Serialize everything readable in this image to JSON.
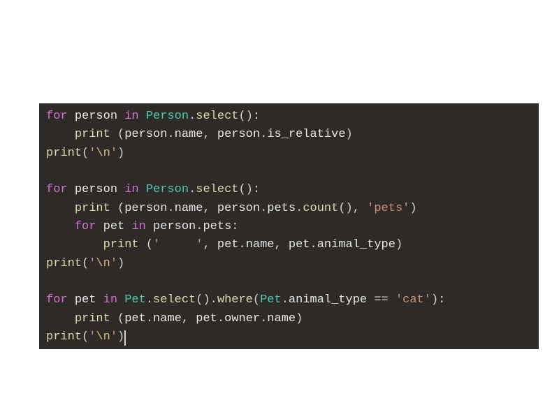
{
  "code": {
    "lines": [
      {
        "tokens": [
          {
            "text": "for",
            "type": "keyword"
          },
          {
            "text": " ",
            "type": "punct"
          },
          {
            "text": "person",
            "type": "variable"
          },
          {
            "text": " ",
            "type": "punct"
          },
          {
            "text": "in",
            "type": "keyword"
          },
          {
            "text": " ",
            "type": "punct"
          },
          {
            "text": "Person",
            "type": "class"
          },
          {
            "text": ".",
            "type": "punct"
          },
          {
            "text": "select",
            "type": "method"
          },
          {
            "text": "():",
            "type": "punct"
          }
        ],
        "indent": 0
      },
      {
        "tokens": [
          {
            "text": "    ",
            "type": "punct"
          },
          {
            "text": "print",
            "type": "builtin"
          },
          {
            "text": " (",
            "type": "punct"
          },
          {
            "text": "person",
            "type": "variable"
          },
          {
            "text": ".",
            "type": "punct"
          },
          {
            "text": "name",
            "type": "property"
          },
          {
            "text": ", ",
            "type": "punct"
          },
          {
            "text": "person",
            "type": "variable"
          },
          {
            "text": ".",
            "type": "punct"
          },
          {
            "text": "is_relative",
            "type": "property"
          },
          {
            "text": ")",
            "type": "punct"
          }
        ],
        "indent": 1
      },
      {
        "tokens": [
          {
            "text": "print",
            "type": "builtin"
          },
          {
            "text": "(",
            "type": "punct"
          },
          {
            "text": "'",
            "type": "string"
          },
          {
            "text": "\\n",
            "type": "string-escape"
          },
          {
            "text": "'",
            "type": "string"
          },
          {
            "text": ")",
            "type": "punct"
          }
        ],
        "indent": 0
      },
      {
        "tokens": [],
        "indent": 0
      },
      {
        "tokens": [
          {
            "text": "for",
            "type": "keyword"
          },
          {
            "text": " ",
            "type": "punct"
          },
          {
            "text": "person",
            "type": "variable"
          },
          {
            "text": " ",
            "type": "punct"
          },
          {
            "text": "in",
            "type": "keyword"
          },
          {
            "text": " ",
            "type": "punct"
          },
          {
            "text": "Person",
            "type": "class"
          },
          {
            "text": ".",
            "type": "punct"
          },
          {
            "text": "select",
            "type": "method"
          },
          {
            "text": "():",
            "type": "punct"
          }
        ],
        "indent": 0
      },
      {
        "tokens": [
          {
            "text": "    ",
            "type": "punct"
          },
          {
            "text": "print",
            "type": "builtin"
          },
          {
            "text": " (",
            "type": "punct"
          },
          {
            "text": "person",
            "type": "variable"
          },
          {
            "text": ".",
            "type": "punct"
          },
          {
            "text": "name",
            "type": "property"
          },
          {
            "text": ", ",
            "type": "punct"
          },
          {
            "text": "person",
            "type": "variable"
          },
          {
            "text": ".",
            "type": "punct"
          },
          {
            "text": "pets",
            "type": "property"
          },
          {
            "text": ".",
            "type": "punct"
          },
          {
            "text": "count",
            "type": "method"
          },
          {
            "text": "(), ",
            "type": "punct"
          },
          {
            "text": "'pets'",
            "type": "string"
          },
          {
            "text": ")",
            "type": "punct"
          }
        ],
        "indent": 1
      },
      {
        "tokens": [
          {
            "text": "    ",
            "type": "punct"
          },
          {
            "text": "for",
            "type": "keyword"
          },
          {
            "text": " ",
            "type": "punct"
          },
          {
            "text": "pet",
            "type": "variable"
          },
          {
            "text": " ",
            "type": "punct"
          },
          {
            "text": "in",
            "type": "keyword"
          },
          {
            "text": " ",
            "type": "punct"
          },
          {
            "text": "person",
            "type": "variable"
          },
          {
            "text": ".",
            "type": "punct"
          },
          {
            "text": "pets",
            "type": "property"
          },
          {
            "text": ":",
            "type": "punct"
          }
        ],
        "indent": 1
      },
      {
        "tokens": [
          {
            "text": "        ",
            "type": "punct"
          },
          {
            "text": "print",
            "type": "builtin"
          },
          {
            "text": " (",
            "type": "punct"
          },
          {
            "text": "'     '",
            "type": "string"
          },
          {
            "text": ", ",
            "type": "punct"
          },
          {
            "text": "pet",
            "type": "variable"
          },
          {
            "text": ".",
            "type": "punct"
          },
          {
            "text": "name",
            "type": "property"
          },
          {
            "text": ", ",
            "type": "punct"
          },
          {
            "text": "pet",
            "type": "variable"
          },
          {
            "text": ".",
            "type": "punct"
          },
          {
            "text": "animal_type",
            "type": "property"
          },
          {
            "text": ")",
            "type": "punct"
          }
        ],
        "indent": 2
      },
      {
        "tokens": [
          {
            "text": "print",
            "type": "builtin"
          },
          {
            "text": "(",
            "type": "punct"
          },
          {
            "text": "'",
            "type": "string"
          },
          {
            "text": "\\n",
            "type": "string-escape"
          },
          {
            "text": "'",
            "type": "string"
          },
          {
            "text": ")",
            "type": "punct"
          }
        ],
        "indent": 0
      },
      {
        "tokens": [],
        "indent": 0
      },
      {
        "tokens": [
          {
            "text": "for",
            "type": "keyword"
          },
          {
            "text": " ",
            "type": "punct"
          },
          {
            "text": "pet",
            "type": "variable"
          },
          {
            "text": " ",
            "type": "punct"
          },
          {
            "text": "in",
            "type": "keyword"
          },
          {
            "text": " ",
            "type": "punct"
          },
          {
            "text": "Pet",
            "type": "class"
          },
          {
            "text": ".",
            "type": "punct"
          },
          {
            "text": "select",
            "type": "method"
          },
          {
            "text": "().",
            "type": "punct"
          },
          {
            "text": "where",
            "type": "method"
          },
          {
            "text": "(",
            "type": "punct"
          },
          {
            "text": "Pet",
            "type": "class"
          },
          {
            "text": ".",
            "type": "punct"
          },
          {
            "text": "animal_type",
            "type": "property"
          },
          {
            "text": " == ",
            "type": "operator"
          },
          {
            "text": "'cat'",
            "type": "string"
          },
          {
            "text": "):",
            "type": "punct"
          }
        ],
        "indent": 0
      },
      {
        "tokens": [
          {
            "text": "    ",
            "type": "punct"
          },
          {
            "text": "print",
            "type": "builtin"
          },
          {
            "text": " (",
            "type": "punct"
          },
          {
            "text": "pet",
            "type": "variable"
          },
          {
            "text": ".",
            "type": "punct"
          },
          {
            "text": "name",
            "type": "property"
          },
          {
            "text": ", ",
            "type": "punct"
          },
          {
            "text": "pet",
            "type": "variable"
          },
          {
            "text": ".",
            "type": "punct"
          },
          {
            "text": "owner",
            "type": "property"
          },
          {
            "text": ".",
            "type": "punct"
          },
          {
            "text": "name",
            "type": "property"
          },
          {
            "text": ")",
            "type": "punct"
          }
        ],
        "indent": 1
      },
      {
        "tokens": [
          {
            "text": "print",
            "type": "builtin"
          },
          {
            "text": "(",
            "type": "punct"
          },
          {
            "text": "'",
            "type": "string"
          },
          {
            "text": "\\n",
            "type": "string-escape"
          },
          {
            "text": "'",
            "type": "string"
          },
          {
            "text": ")",
            "type": "punct"
          }
        ],
        "indent": 0,
        "has_cursor": true
      }
    ]
  }
}
